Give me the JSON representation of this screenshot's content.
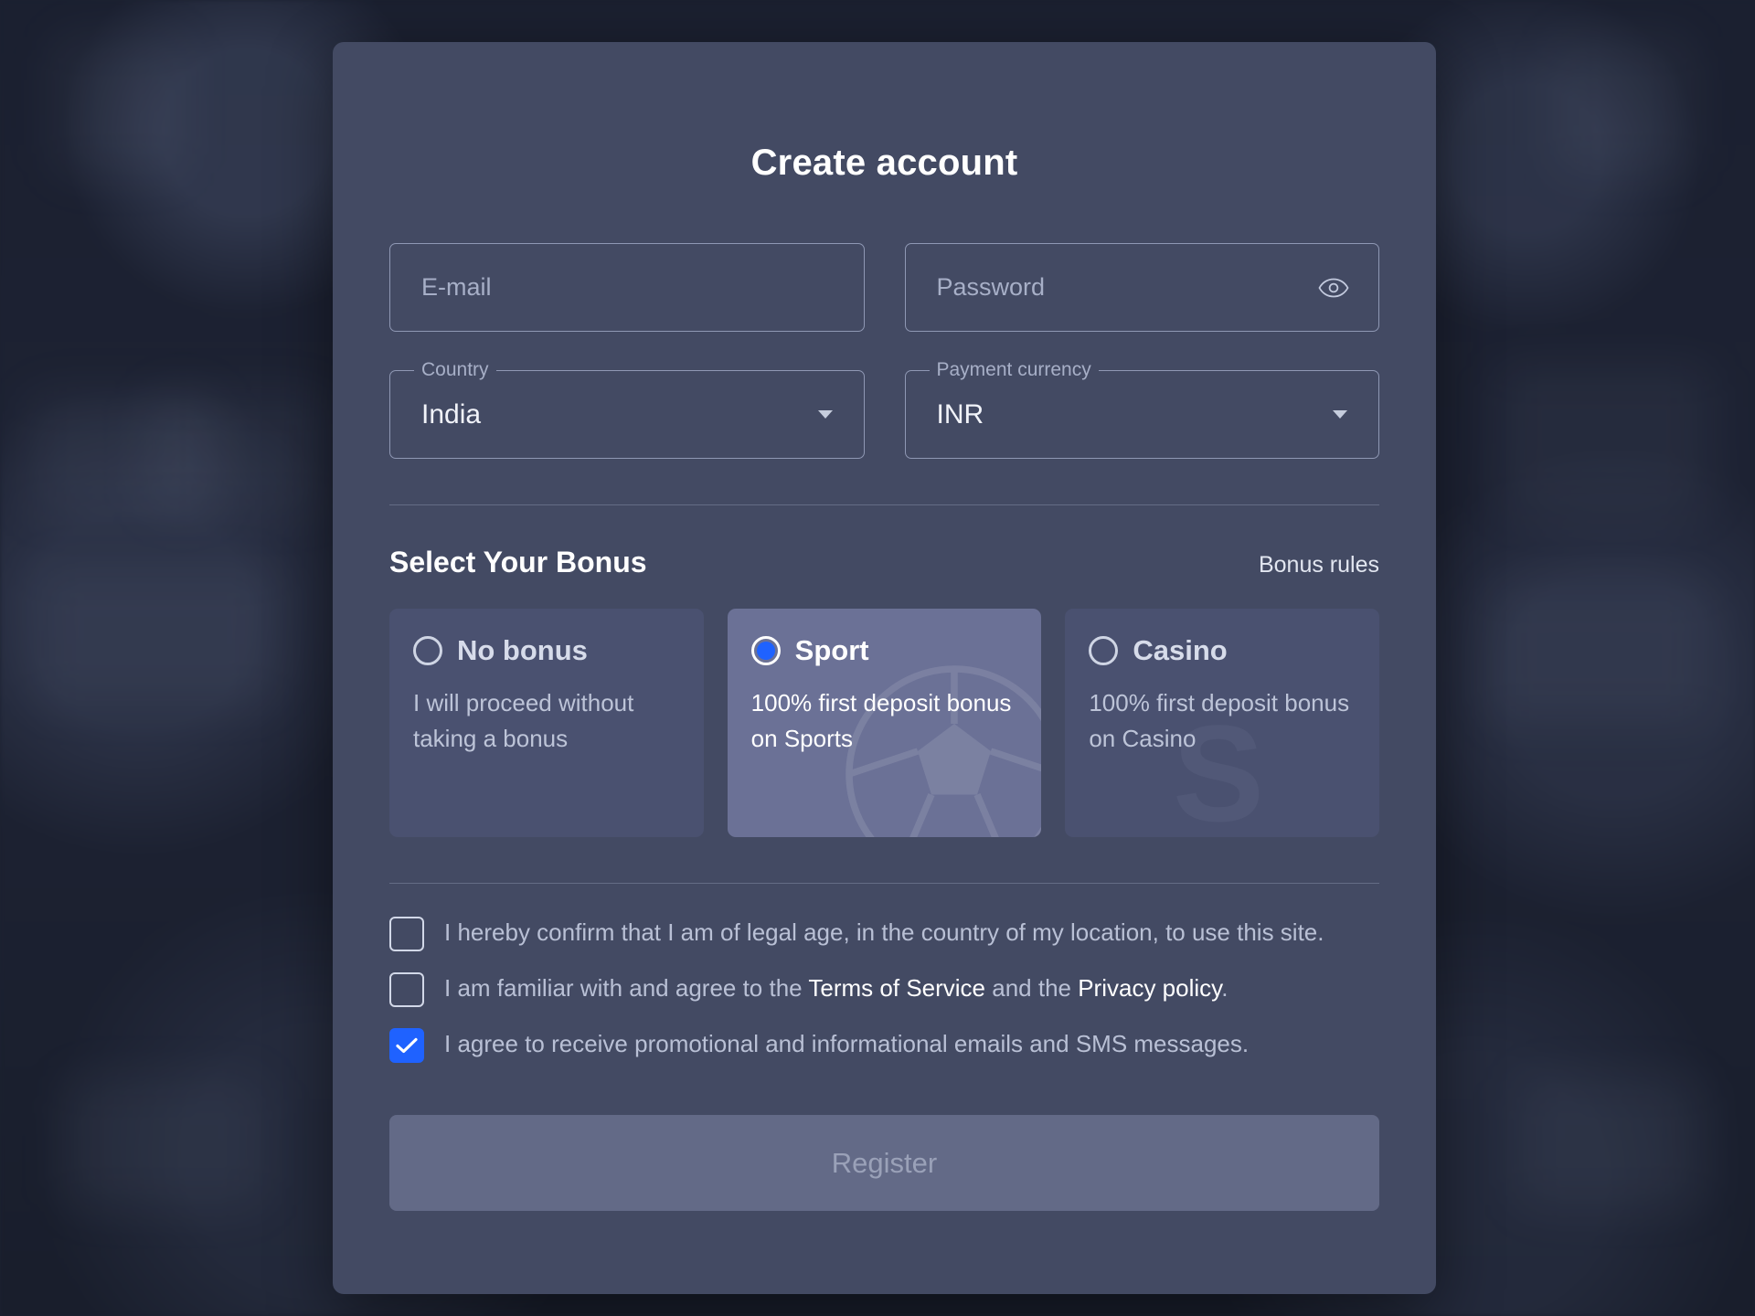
{
  "modal": {
    "title": "Create account"
  },
  "form": {
    "email": {
      "placeholder": "E-mail",
      "value": ""
    },
    "password": {
      "placeholder": "Password",
      "value": "",
      "toggle_icon": "eye-icon"
    },
    "country": {
      "label": "Country",
      "value": "India",
      "caret_icon": "chevron-down-icon"
    },
    "currency": {
      "label": "Payment currency",
      "value": "INR",
      "caret_icon": "chevron-down-icon"
    }
  },
  "bonus": {
    "heading": "Select Your Bonus",
    "rules_link": "Bonus rules",
    "selected": "Sport",
    "options": [
      {
        "label": "No bonus",
        "description": "I will proceed without taking a bonus",
        "selected": false
      },
      {
        "label": "Sport",
        "description": "100% first deposit bonus on Sports",
        "selected": true
      },
      {
        "label": "Casino",
        "description": "100% first deposit bonus on Casino",
        "selected": false
      }
    ]
  },
  "terms": [
    {
      "checked": false,
      "text": "I hereby confirm that I am of legal age, in the country of my location, to use this site."
    },
    {
      "checked": false,
      "prefix": "I am familiar with and agree to the ",
      "link1": "Terms of Service",
      "middle": " and the ",
      "link2": "Privacy policy",
      "suffix": "."
    },
    {
      "checked": true,
      "text": "I agree to receive promotional and informational emails and SMS messages."
    }
  ],
  "submit": {
    "label": "Register",
    "enabled": false
  },
  "colors": {
    "modal_bg": "#434a63",
    "page_bg": "#1c2131",
    "accent": "#1f62ff",
    "card_bg": "#4a5170",
    "card_selected_bg": "#6b7196",
    "button_disabled_bg": "#636a87",
    "border": "#8f98b4"
  }
}
